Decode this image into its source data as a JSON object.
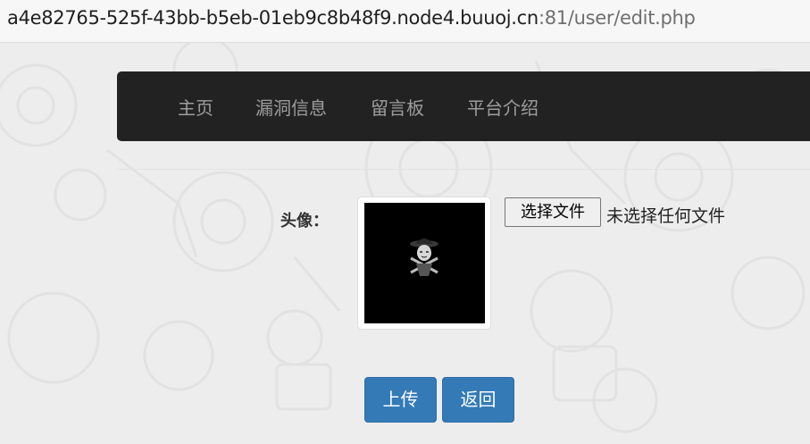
{
  "browser": {
    "url_host": "a4e82765-525f-43bb-b5eb-01eb9c8b48f9.node4.buuoj.cn",
    "url_path": ":81/user/edit.php"
  },
  "nav": {
    "items": [
      {
        "label": "主页"
      },
      {
        "label": "漏洞信息"
      },
      {
        "label": "留言板"
      },
      {
        "label": "平台介绍"
      }
    ]
  },
  "form": {
    "avatar_label": "头像：",
    "file_button_label": "选择文件",
    "file_status": "未选择任何文件",
    "upload_label": "上传",
    "back_label": "返回"
  },
  "colors": {
    "navbar_bg": "#222222",
    "nav_text": "#9d9d9d",
    "primary_button": "#337ab7",
    "page_bg": "#ededed"
  }
}
